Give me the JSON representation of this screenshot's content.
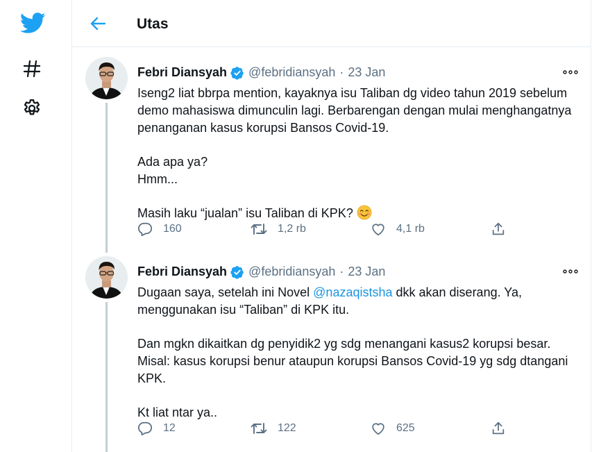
{
  "sidebar": {
    "items": [
      {
        "icon": "twitter-logo-icon"
      },
      {
        "icon": "hashtag-icon"
      },
      {
        "icon": "settings-gear-icon"
      }
    ]
  },
  "header": {
    "back_icon": "arrow-left-icon",
    "title": "Utas"
  },
  "colors": {
    "brand_blue": "#1da1f2",
    "text": "#0f1419",
    "secondary": "#5b7083",
    "link": "#1b95e0",
    "thread_line": "#c4cfd6"
  },
  "tweets": [
    {
      "author": "Febri Diansyah",
      "verified": true,
      "handle": "@febridiansyah",
      "separator": "·",
      "date": "23 Jan",
      "body": {
        "p1": "Iseng2 liat bbrpa mention, kayaknya isu Taliban dg video tahun 2019 sebelum demo mahasiswa dimunculin lagi. Berbarengan dengan mulai menghangatnya penanganan kasus korupsi Bansos Covid-19.",
        "p2": "Ada apa ya?\nHmm...",
        "p3": "Masih laku “jualan” isu Taliban di KPK? ",
        "p3_emoji": "smiling-face-emoji"
      },
      "replies": "160",
      "retweets": "1,2 rb",
      "likes": "4,1 rb"
    },
    {
      "author": "Febri Diansyah",
      "verified": true,
      "handle": "@febridiansyah",
      "separator": "·",
      "date": "23 Jan",
      "body": {
        "p1_before": "Dugaan saya, setelah ini Novel ",
        "p1_mention": "@nazaqistsha",
        "p1_after": " dkk akan diserang. Ya, menggunakan isu “Taliban” di KPK itu.",
        "p2": "Dan mgkn dikaitkan dg penyidik2 yg sdg menangani kasus2 korupsi besar. Misal: kasus korupsi benur ataupun korupsi Bansos Covid-19 yg sdg dtangani KPK.",
        "p3": "Kt liat ntar ya.."
      },
      "replies": "12",
      "retweets": "122",
      "likes": "625"
    }
  ]
}
